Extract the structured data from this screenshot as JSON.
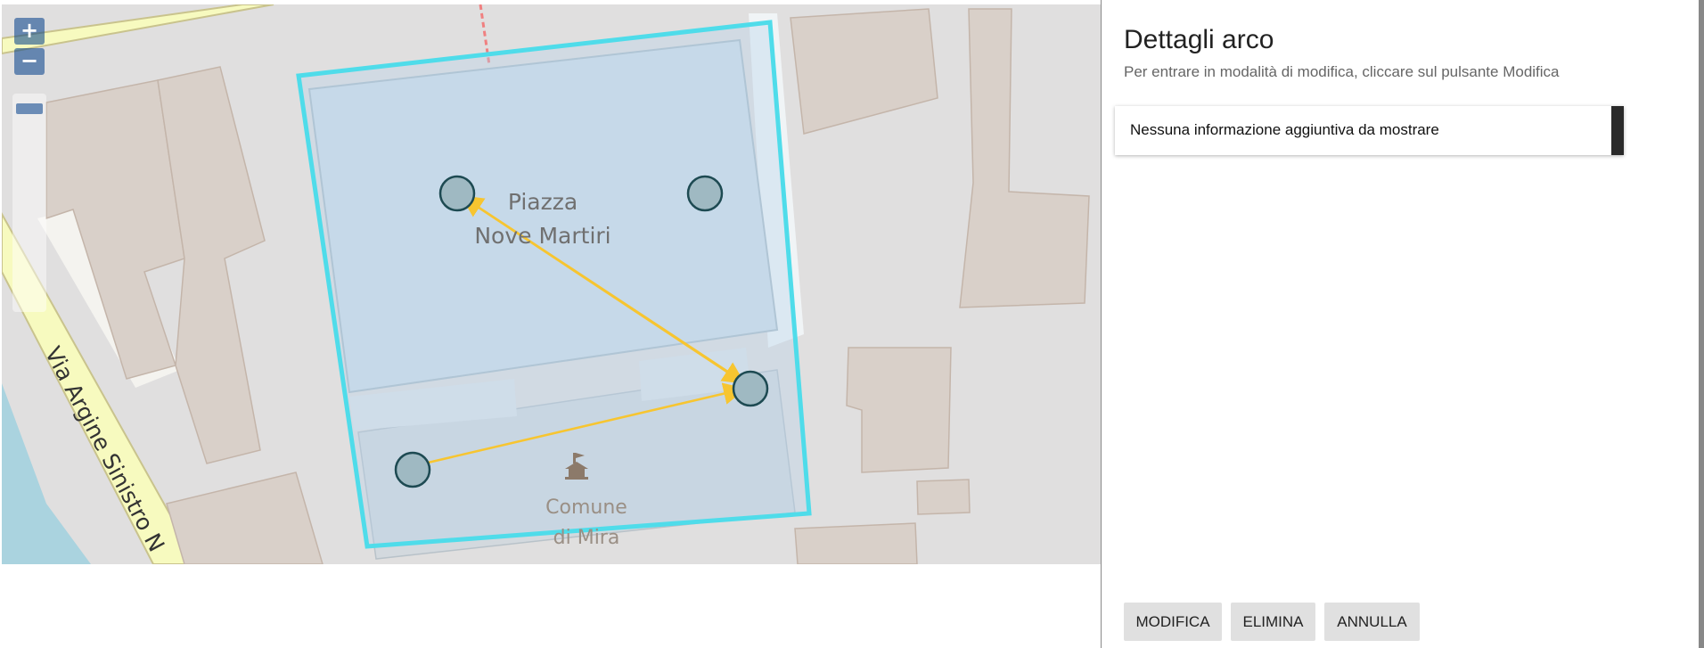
{
  "map": {
    "labels": {
      "square_line1": "Piazza",
      "square_line2": "Nove Martiri",
      "townhall_line1": "Comune",
      "townhall_line2": "di Mira",
      "street": "Via Argine Sinistro N"
    },
    "zoom_in_label": "+",
    "zoom_out_label": "−",
    "colors": {
      "selection": "#4fdcea",
      "arc": "#f7c530",
      "node_fill": "#9fb9c2",
      "node_stroke": "#1d4a52"
    },
    "icons": [
      "townhall-icon"
    ]
  },
  "panel": {
    "title": "Dettagli arco",
    "subtitle": "Per entrare in modalità di modifica, cliccare sul pulsante Modifica",
    "info_text": "Nessuna informazione aggiuntiva da mostrare",
    "buttons": {
      "modifica": "MODIFICA",
      "elimina": "ELIMINA",
      "annulla": "ANNULLA"
    }
  }
}
